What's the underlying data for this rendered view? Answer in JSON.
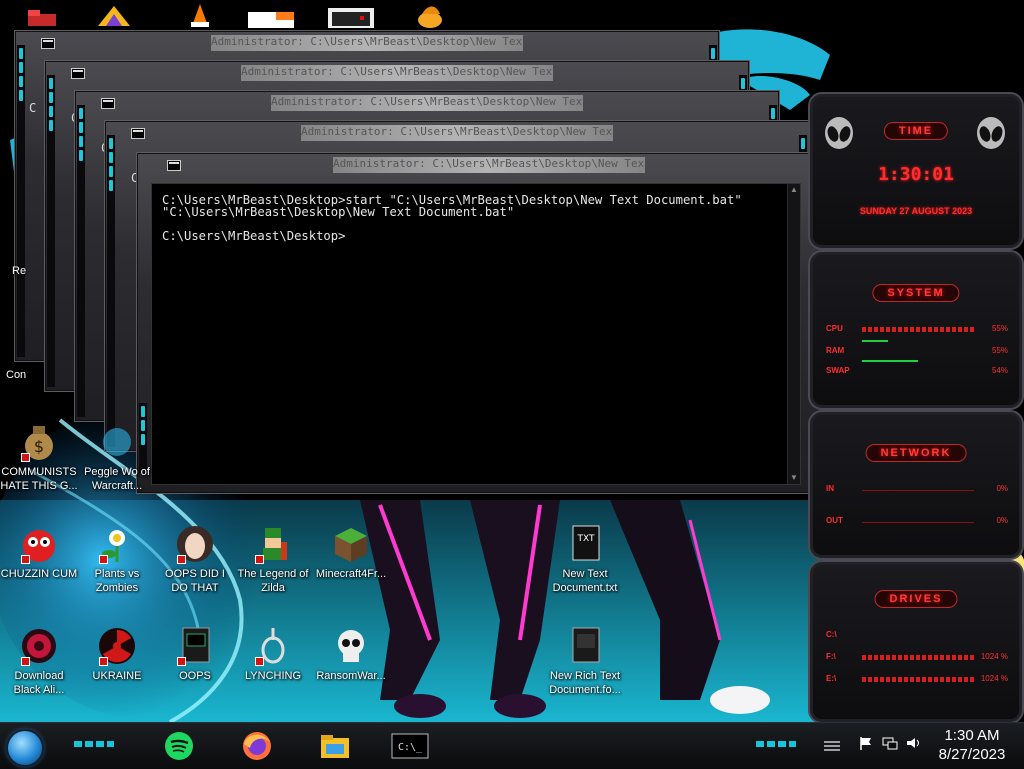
{
  "console": {
    "title": "Administrator: C:\\Users\\MrBeast\\Desktop\\New Text Document.bat",
    "lines": [
      "C:\\Users\\MrBeast\\Desktop>start \"C:\\Users\\MrBeast\\Desktop\\New Text Document.bat\"",
      "\"C:\\Users\\MrBeast\\Desktop\\New Text Document.bat\"",
      "",
      "C:\\Users\\MrBeast\\Desktop>"
    ],
    "side_letter": "C"
  },
  "widgets": {
    "time": {
      "header": "TIME",
      "clock": "1:30:01",
      "date": "SUNDAY 27 AUGUST 2023"
    },
    "system": {
      "header": "SYSTEM",
      "rows": [
        {
          "label": "CPU",
          "value": "55%"
        },
        {
          "label": "RAM",
          "value": "55%"
        },
        {
          "label": "SWAP",
          "value": "54%"
        }
      ]
    },
    "network": {
      "header": "NETWORK",
      "rows": [
        {
          "label": "IN",
          "value": "0%"
        },
        {
          "label": "OUT",
          "value": "0%"
        }
      ]
    },
    "drives": {
      "header": "DRIVES",
      "rows": [
        {
          "label": "C:\\",
          "value": ""
        },
        {
          "label": "F:\\",
          "value": "1024 %"
        },
        {
          "label": "E:\\",
          "value": "1024 %"
        }
      ]
    }
  },
  "desktop": {
    "partial_labels": {
      "left_top": "Re",
      "left_mid": "Con"
    },
    "icons": [
      {
        "label": "COMMUNISTS HATE THIS G...",
        "icon": "money-bag-icon"
      },
      {
        "label": "Peggle Wo of Warcraft...",
        "icon": "peggle-icon"
      },
      {
        "label": "CHUZZIN CUM",
        "icon": "chuzzle-icon"
      },
      {
        "label": "Plants vs Zombies",
        "icon": "flower-icon"
      },
      {
        "label": "OOPS DID I DO THAT",
        "icon": "portrait-icon"
      },
      {
        "label": "The Legend of Zilda",
        "icon": "pixel-hero-icon"
      },
      {
        "label": "Minecraft4Fr...",
        "icon": "grass-block-icon"
      },
      {
        "label": "New Text Document.txt",
        "icon": "text-file-icon"
      },
      {
        "label": "Download Black Ali...",
        "icon": "alien-orb-icon"
      },
      {
        "label": "UKRAINE",
        "icon": "radiation-icon"
      },
      {
        "label": "OOPS",
        "icon": "console-file-icon"
      },
      {
        "label": "LYNCHING",
        "icon": "noose-icon"
      },
      {
        "label": "RansomWar...",
        "icon": "skull-icon"
      },
      {
        "label": "New Rich Text Document.fo...",
        "icon": "rich-text-icon"
      }
    ]
  },
  "taskbar": {
    "apps": [
      "spotify-icon",
      "firefox-icon",
      "file-explorer-icon",
      "command-prompt-icon"
    ],
    "clock_time": "1:30 AM",
    "clock_date": "8/27/2023"
  },
  "colors": {
    "accent_cyan": "#1fc7d8",
    "widget_red": "#ff2e2e",
    "console_bg": "#000000"
  }
}
